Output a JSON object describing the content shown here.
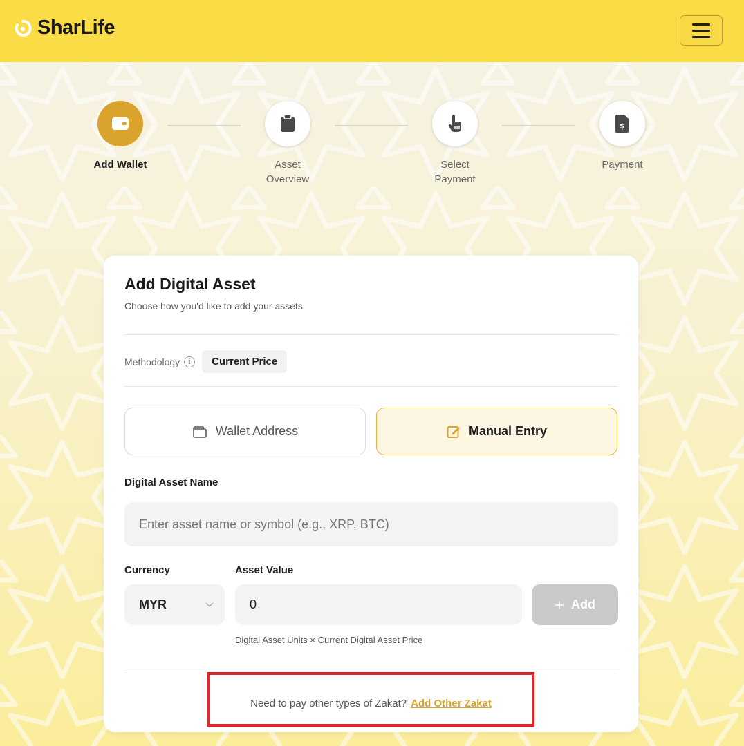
{
  "header": {
    "brand": "SharLife",
    "menu_icon": "hamburger-icon"
  },
  "stepper": {
    "steps": [
      {
        "label": "Add Wallet",
        "icon": "wallet-icon",
        "active": true
      },
      {
        "label": "Asset\nOverview",
        "icon": "clipboard-icon",
        "active": false
      },
      {
        "label": "Select\nPayment",
        "icon": "pointer-hand-icon",
        "active": false
      },
      {
        "label": "Payment",
        "icon": "invoice-dollar-icon",
        "active": false
      }
    ]
  },
  "card": {
    "title": "Add Digital Asset",
    "subtitle": "Choose how you'd like to add your assets",
    "methodology_label": "Methodology",
    "methodology_value": "Current Price",
    "wallet_address_label": "Wallet Address",
    "manual_entry_label": "Manual Entry",
    "asset_name_label": "Digital Asset Name",
    "asset_name_placeholder": "Enter asset name or symbol (e.g., XRP, BTC)",
    "currency_label": "Currency",
    "currency_value": "MYR",
    "asset_value_label": "Asset Value",
    "asset_value": "0",
    "add_label": "Add",
    "hint": "Digital Asset Units × Current Digital Asset Price",
    "footer_question": "Need to pay other types of Zakat?",
    "footer_link": "Add Other Zakat"
  },
  "colors": {
    "header_bg": "#f9dc46",
    "accent": "#d9a32e",
    "highlight_box": "#e4262a"
  }
}
